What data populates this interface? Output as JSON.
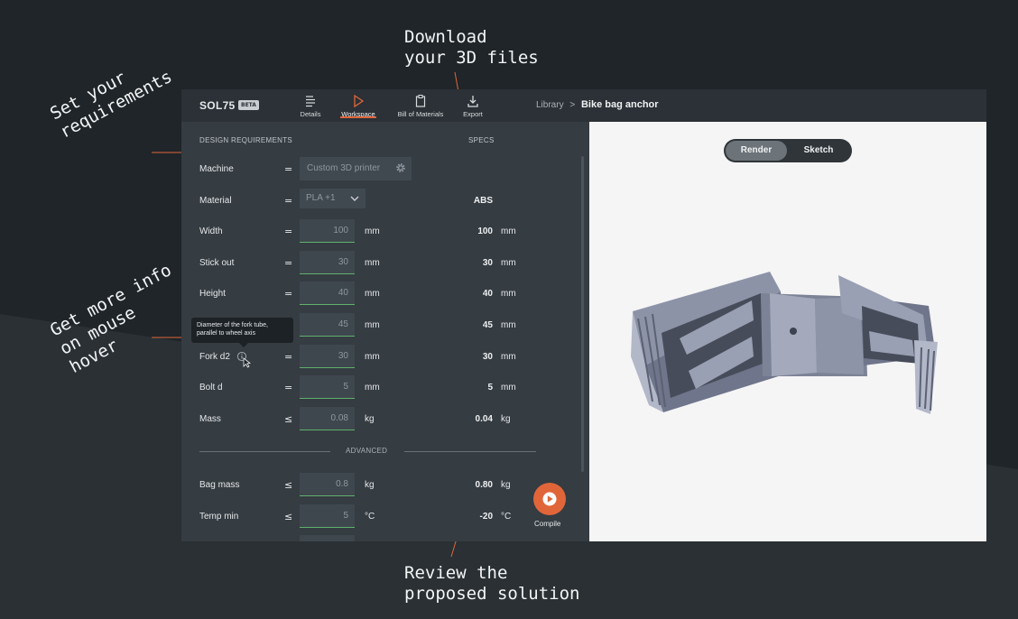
{
  "annotations": {
    "download": "Download\nyour 3D files",
    "requirements": "Set your\nrequirements",
    "hover": "Get more info\non mouse\nhover",
    "review": "Review the\nproposed solution"
  },
  "colors": {
    "accent": "#e0663a",
    "input_valid": "#5fb06b",
    "background": "#1f2529",
    "panel": "#353c42",
    "viewer": "#f5f5f6"
  },
  "app": {
    "logo": "SOL75",
    "badge": "BETA",
    "nav": [
      {
        "label": "Details",
        "icon": "details-icon"
      },
      {
        "label": "Workspace",
        "icon": "play-outline-icon"
      },
      {
        "label": "Bill of Materials",
        "icon": "clipboard-icon"
      },
      {
        "label": "Export",
        "icon": "download-icon"
      }
    ],
    "breadcrumb": {
      "parent": "Library",
      "separator": ">",
      "current": "Bike bag anchor"
    }
  },
  "panel": {
    "design_requirements": "DESIGN REQUIREMENTS",
    "specs": "SPECS",
    "machine": {
      "label": "Machine",
      "op": "=",
      "value": "Custom 3D printer"
    },
    "material": {
      "label": "Material",
      "op": "=",
      "value": "PLA +1",
      "spec": "ABS"
    },
    "rows": [
      {
        "label": "Width",
        "op": "=",
        "value": "100",
        "unit": "mm",
        "spec": "100",
        "spec_unit": "mm"
      },
      {
        "label": "Stick out",
        "op": "=",
        "value": "30",
        "unit": "mm",
        "spec": "30",
        "spec_unit": "mm"
      },
      {
        "label": "Height",
        "op": "=",
        "value": "40",
        "unit": "mm",
        "spec": "40",
        "spec_unit": "mm"
      },
      {
        "label": "",
        "op": "",
        "value": "45",
        "unit": "mm",
        "spec": "45",
        "spec_unit": "mm"
      },
      {
        "label": "Fork d2",
        "op": "=",
        "value": "30",
        "unit": "mm",
        "spec": "30",
        "spec_unit": "mm"
      },
      {
        "label": "Bolt d",
        "op": "=",
        "value": "5",
        "unit": "mm",
        "spec": "5",
        "spec_unit": "mm"
      },
      {
        "label": "Mass",
        "op": "≤",
        "value": "0.08",
        "unit": "kg",
        "spec": "0.04",
        "spec_unit": "kg"
      }
    ],
    "advanced": "ADVANCED",
    "advanced_rows": [
      {
        "label": "Bag mass",
        "op": "≤",
        "value": "0.8",
        "unit": "kg",
        "spec": "0.80",
        "spec_unit": "kg"
      },
      {
        "label": "Temp min",
        "op": "≤",
        "value": "5",
        "unit": "°C",
        "spec": "-20",
        "spec_unit": "°C"
      }
    ],
    "tooltip": "Diameter of the fork tube,\nparallel to wheel axis",
    "compile": "Compile"
  },
  "viewer": {
    "render": "Render",
    "sketch": "Sketch",
    "active_mode": "Render"
  }
}
